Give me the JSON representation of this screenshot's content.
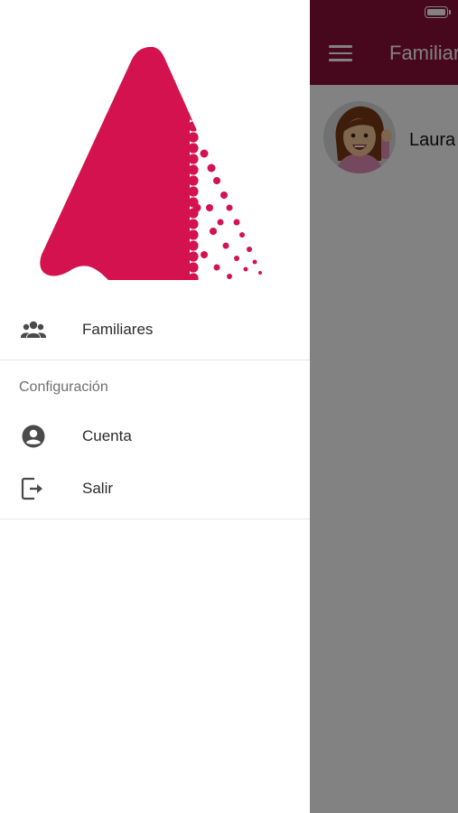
{
  "app": {
    "title": "Familiares",
    "bar_color": "#8b0e3a",
    "contact_name": "Laura"
  },
  "drawer": {
    "brand_color": "#d3124f",
    "primary_items": [
      {
        "label": "Familiares",
        "icon": "group-icon"
      }
    ],
    "section_title": "Configuración",
    "config_items": [
      {
        "label": "Cuenta",
        "icon": "account-circle-icon"
      },
      {
        "label": "Salir",
        "icon": "logout-icon"
      }
    ]
  }
}
